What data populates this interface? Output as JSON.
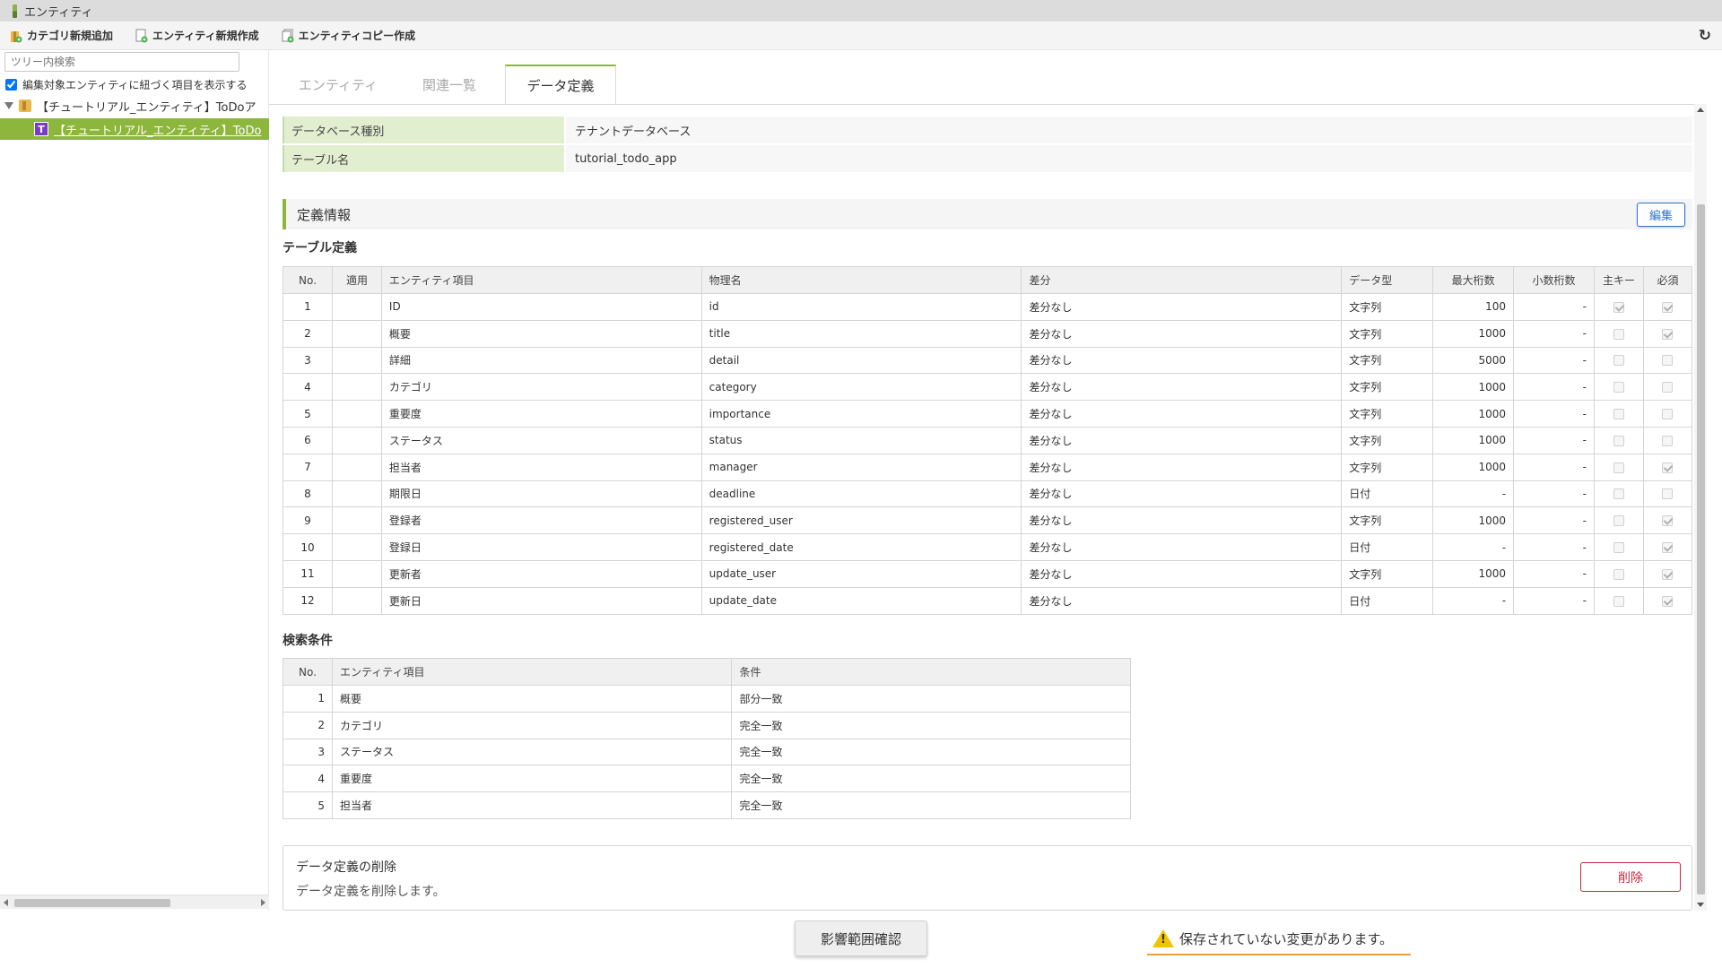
{
  "window": {
    "title": "エンティティ"
  },
  "toolbar": {
    "add_category": "カテゴリ新規追加",
    "new_entity": "エンティティ新規作成",
    "copy_entity": "エンティティコピー作成"
  },
  "sidebar": {
    "search_placeholder": "ツリー内検索",
    "show_related_label": "編集対象エンティティに紐づく項目を表示する",
    "tree_root": "【チュートリアル_エンティティ】ToDoア",
    "tree_child_badge": "T",
    "tree_child": "【チュートリアル_エンティティ】ToDo"
  },
  "tabs": [
    {
      "label": "エンティティ",
      "active": false
    },
    {
      "label": "関連一覧",
      "active": false
    },
    {
      "label": "データ定義",
      "active": true
    }
  ],
  "info": {
    "db_type_label": "データベース種別",
    "db_type_value": "テナントデータベース",
    "table_name_label": "テーブル名",
    "table_name_value": "tutorial_todo_app"
  },
  "definition": {
    "section_title": "定義情報",
    "edit_label": "編集",
    "table_title": "テーブル定義",
    "columns": [
      "No.",
      "適用",
      "エンティティ項目",
      "物理名",
      "差分",
      "データ型",
      "最大桁数",
      "小数桁数",
      "主キー",
      "必須"
    ],
    "rows": [
      {
        "no": "1",
        "apply": "",
        "item": "ID",
        "physical": "id",
        "diff": "差分なし",
        "type": "文字列",
        "max": "100",
        "scale": "-",
        "pk": true,
        "required": true
      },
      {
        "no": "2",
        "apply": "",
        "item": "概要",
        "physical": "title",
        "diff": "差分なし",
        "type": "文字列",
        "max": "1000",
        "scale": "-",
        "pk": false,
        "required": true
      },
      {
        "no": "3",
        "apply": "",
        "item": "詳細",
        "physical": "detail",
        "diff": "差分なし",
        "type": "文字列",
        "max": "5000",
        "scale": "-",
        "pk": false,
        "required": false
      },
      {
        "no": "4",
        "apply": "",
        "item": "カテゴリ",
        "physical": "category",
        "diff": "差分なし",
        "type": "文字列",
        "max": "1000",
        "scale": "-",
        "pk": false,
        "required": false
      },
      {
        "no": "5",
        "apply": "",
        "item": "重要度",
        "physical": "importance",
        "diff": "差分なし",
        "type": "文字列",
        "max": "1000",
        "scale": "-",
        "pk": false,
        "required": false
      },
      {
        "no": "6",
        "apply": "",
        "item": "ステータス",
        "physical": "status",
        "diff": "差分なし",
        "type": "文字列",
        "max": "1000",
        "scale": "-",
        "pk": false,
        "required": false
      },
      {
        "no": "7",
        "apply": "",
        "item": "担当者",
        "physical": "manager",
        "diff": "差分なし",
        "type": "文字列",
        "max": "1000",
        "scale": "-",
        "pk": false,
        "required": true
      },
      {
        "no": "8",
        "apply": "",
        "item": "期限日",
        "physical": "deadline",
        "diff": "差分なし",
        "type": "日付",
        "max": "-",
        "scale": "-",
        "pk": false,
        "required": false
      },
      {
        "no": "9",
        "apply": "",
        "item": "登録者",
        "physical": "registered_user",
        "diff": "差分なし",
        "type": "文字列",
        "max": "1000",
        "scale": "-",
        "pk": false,
        "required": true
      },
      {
        "no": "10",
        "apply": "",
        "item": "登録日",
        "physical": "registered_date",
        "diff": "差分なし",
        "type": "日付",
        "max": "-",
        "scale": "-",
        "pk": false,
        "required": true
      },
      {
        "no": "11",
        "apply": "",
        "item": "更新者",
        "physical": "update_user",
        "diff": "差分なし",
        "type": "文字列",
        "max": "1000",
        "scale": "-",
        "pk": false,
        "required": true
      },
      {
        "no": "12",
        "apply": "",
        "item": "更新日",
        "physical": "update_date",
        "diff": "差分なし",
        "type": "日付",
        "max": "-",
        "scale": "-",
        "pk": false,
        "required": true
      }
    ]
  },
  "search": {
    "title": "検索条件",
    "columns": [
      "No.",
      "エンティティ項目",
      "条件"
    ],
    "rows": [
      {
        "no": "1",
        "item": "概要",
        "cond": "部分一致"
      },
      {
        "no": "2",
        "item": "カテゴリ",
        "cond": "完全一致"
      },
      {
        "no": "3",
        "item": "ステータス",
        "cond": "完全一致"
      },
      {
        "no": "4",
        "item": "重要度",
        "cond": "完全一致"
      },
      {
        "no": "5",
        "item": "担当者",
        "cond": "完全一致"
      }
    ]
  },
  "delete_section": {
    "title": "データ定義の削除",
    "description": "データ定義を削除します。",
    "button": "削除"
  },
  "footer": {
    "impact_button": "影響範囲確認",
    "unsaved_message": "保存されていない変更があります。"
  },
  "colors": {
    "accent": "#8cb63c",
    "edit": "#2f73c8",
    "danger": "#c8283a",
    "warning": "#f2c200"
  }
}
